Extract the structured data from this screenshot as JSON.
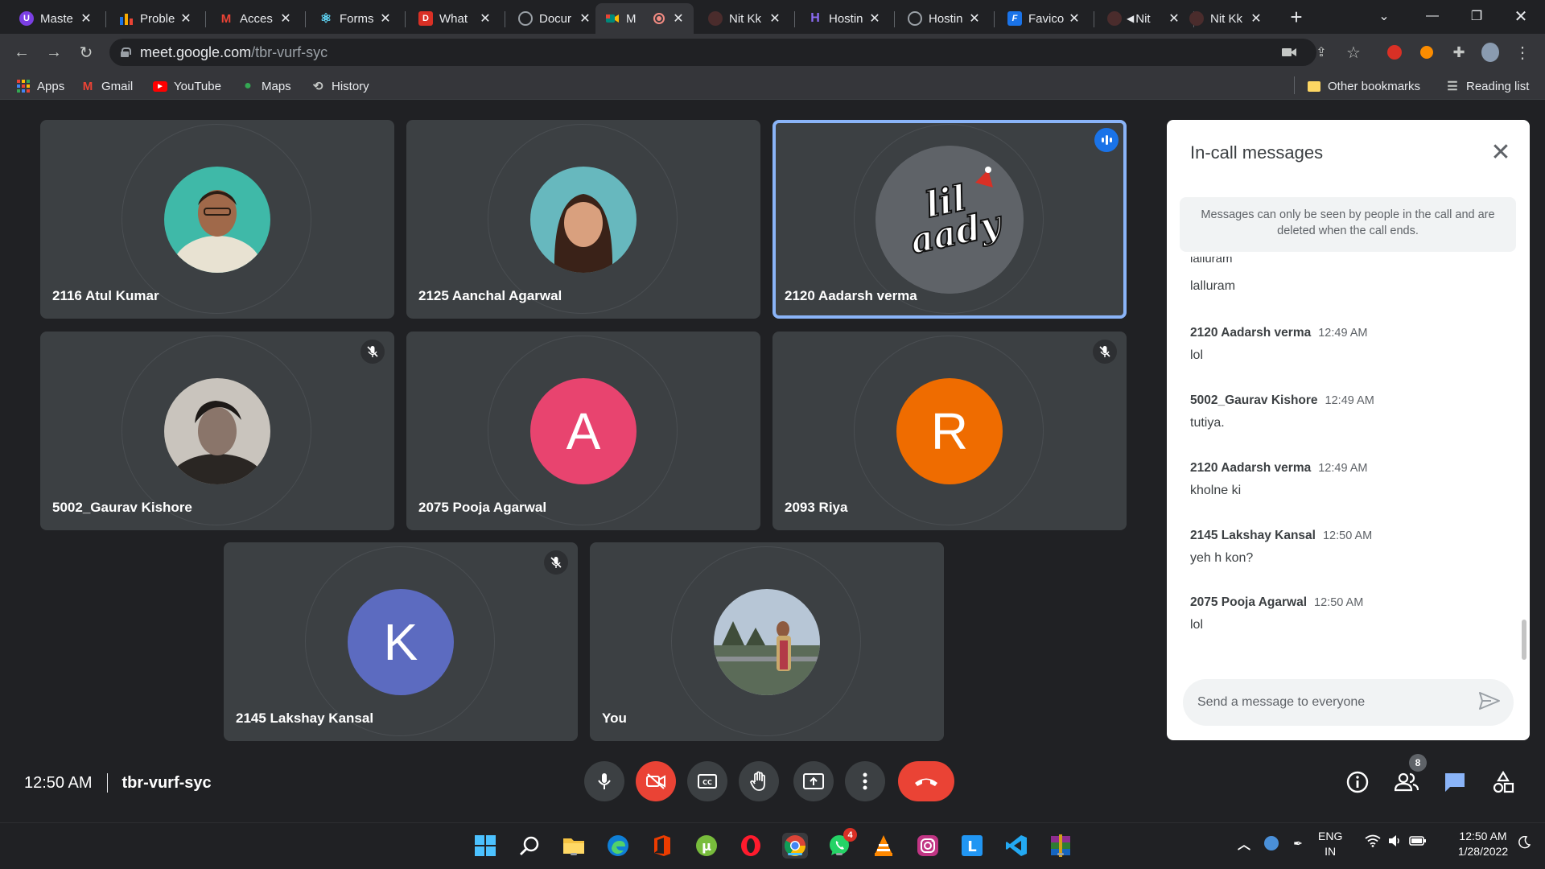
{
  "browser": {
    "tabs": [
      {
        "title": "Maste",
        "favicon_color": "#7b3fe4",
        "favicon_glyph": "U"
      },
      {
        "title": "Proble",
        "favicon_color": "#f9ab00",
        "favicon_glyph": "bar-chart"
      },
      {
        "title": "Acces",
        "favicon_color": "#ea4335",
        "favicon_glyph": "M"
      },
      {
        "title": "Forms",
        "favicon_color": "#61dafb",
        "favicon_glyph": "react"
      },
      {
        "title": "What",
        "favicon_color": "#d93025",
        "favicon_glyph": "D"
      },
      {
        "title": "Docur",
        "favicon_color": "#9aa0a6",
        "favicon_glyph": "globe"
      },
      {
        "title": "M",
        "favicon_color": "#00897b",
        "favicon_glyph": "meet",
        "active": true
      },
      {
        "title": "Nit Kk",
        "favicon_color": "#5c2b2b",
        "favicon_glyph": "github"
      },
      {
        "title": "Hostin",
        "favicon_color": "#673de6",
        "favicon_glyph": "H"
      },
      {
        "title": "Hostin",
        "favicon_color": "#9aa0a6",
        "favicon_glyph": "globe"
      },
      {
        "title": "Favico",
        "favicon_color": "#1a73e8",
        "favicon_glyph": "F"
      },
      {
        "title": "Nit",
        "favicon_color": "#5c2b2b",
        "favicon_glyph": "github"
      },
      {
        "title": "Nit Kk",
        "favicon_color": "#5c2b2b",
        "favicon_glyph": "github"
      }
    ],
    "new_tab": "+",
    "url_host": "meet.google.com",
    "url_path": "/tbr-vurf-syc",
    "bookmarks": [
      {
        "label": "Apps",
        "icon": "apps-grid-icon"
      },
      {
        "label": "Gmail",
        "icon": "gmail-icon"
      },
      {
        "label": "YouTube",
        "icon": "youtube-icon"
      },
      {
        "label": "Maps",
        "icon": "maps-icon"
      },
      {
        "label": "History",
        "icon": "history-icon"
      }
    ],
    "other_bookmarks": "Other bookmarks",
    "reading_list": "Reading list"
  },
  "meet": {
    "participants": [
      {
        "name": "2116 Atul Kumar",
        "avatar": "photo",
        "muted": false
      },
      {
        "name": "2125 Aanchal Agarwal",
        "avatar": "photo",
        "muted": false
      },
      {
        "name": "2120 Aadarsh verma",
        "avatar": "logo",
        "muted": false,
        "speaking": true
      },
      {
        "name": "5002_Gaurav Kishore",
        "avatar": "photo",
        "muted": true
      },
      {
        "name": "2075 Pooja Agarwal",
        "avatar": "letter",
        "initial": "A",
        "color": "#e8446f",
        "muted": false
      },
      {
        "name": "2093 Riya",
        "avatar": "letter",
        "initial": "R",
        "color": "#ef6c00",
        "muted": true
      },
      {
        "name": "2145 Lakshay Kansal",
        "avatar": "letter",
        "initial": "K",
        "color": "#5c6bc0",
        "muted": true
      },
      {
        "name": "You",
        "avatar": "photo",
        "muted": false
      }
    ],
    "logo_text": "lil aady",
    "time": "12:50 AM",
    "meeting_code": "tbr-vurf-syc",
    "participant_count": "8"
  },
  "chat": {
    "title": "In-call messages",
    "notice": "Messages can only be seen by people in the call and are deleted when the call ends.",
    "cut_message": "lalluram",
    "first_text": "lalluram",
    "messages": [
      {
        "sender": "2120 Aadarsh verma",
        "time": "12:49 AM",
        "text": "lol"
      },
      {
        "sender": "5002_Gaurav Kishore",
        "time": "12:49 AM",
        "text": "tutiya."
      },
      {
        "sender": "2120 Aadarsh verma",
        "time": "12:49 AM",
        "text": "kholne ki"
      },
      {
        "sender": "2145 Lakshay Kansal",
        "time": "12:50 AM",
        "text": "yeh h kon?"
      },
      {
        "sender": "2075 Pooja Agarwal",
        "time": "12:50 AM",
        "text": "lol"
      }
    ],
    "input_placeholder": "Send a message to everyone"
  },
  "taskbar": {
    "whatsapp_badge": "4",
    "lang_line1": "ENG",
    "lang_line2": "IN",
    "clock_time": "12:50 AM",
    "clock_date": "1/28/2022"
  }
}
